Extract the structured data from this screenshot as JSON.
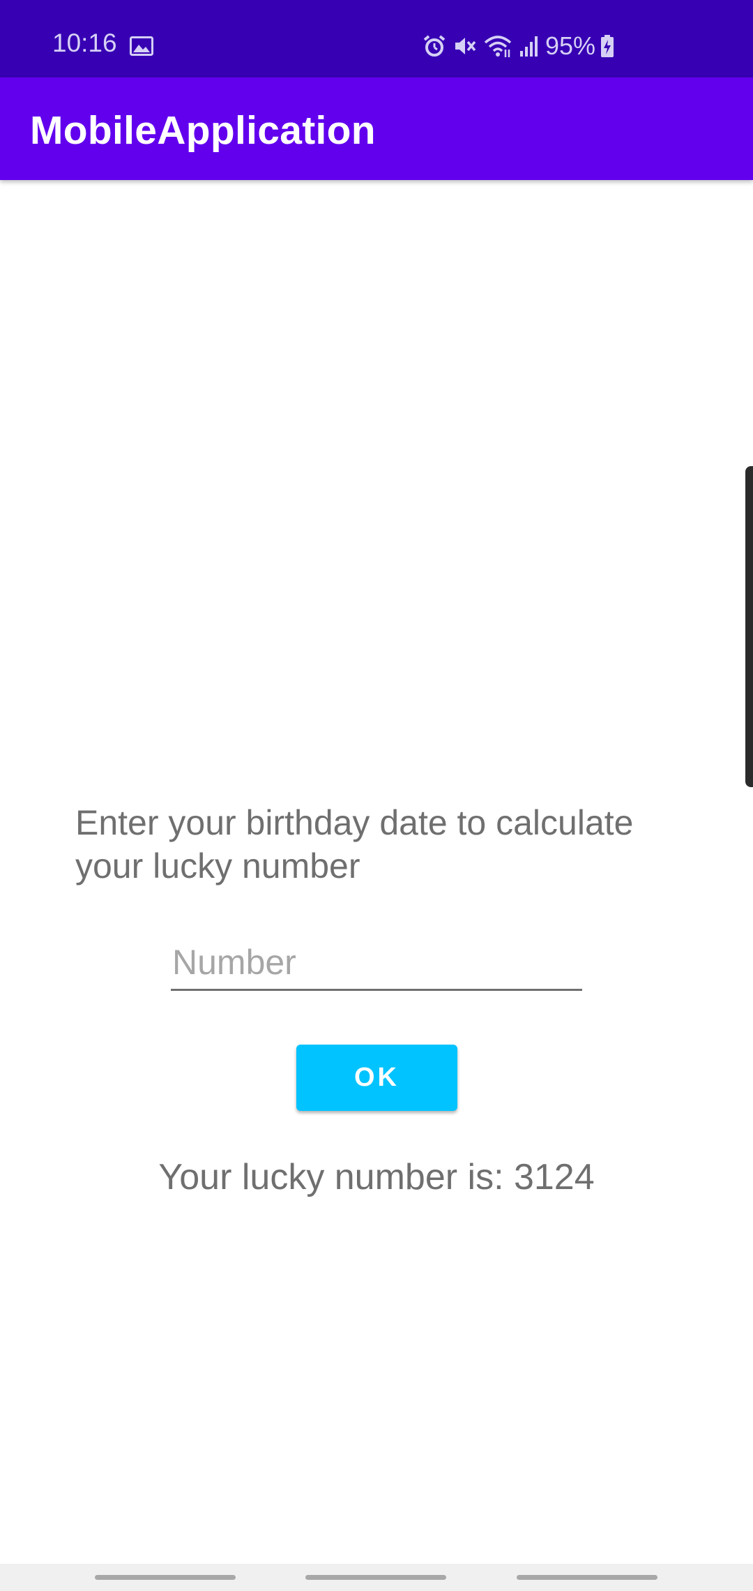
{
  "status_bar": {
    "time": "10:16",
    "battery_percent": "95%",
    "icons": [
      "gallery-icon",
      "alarm-icon",
      "mute-icon",
      "wifi-icon",
      "signal-icon",
      "battery-charging-icon"
    ],
    "background_color": "#3700B3"
  },
  "app_bar": {
    "title": "MobileApplication",
    "background_color": "#6200EE"
  },
  "content": {
    "prompt": "Enter your birthday date to calculate your lucky number",
    "input_placeholder": "Number",
    "input_value": "",
    "ok_button_label": "OK",
    "ok_button_color": "#00C3FF",
    "result": "Your lucky number is: 3124"
  },
  "nav_bar": {
    "items": [
      "recent-apps",
      "home",
      "back"
    ]
  }
}
